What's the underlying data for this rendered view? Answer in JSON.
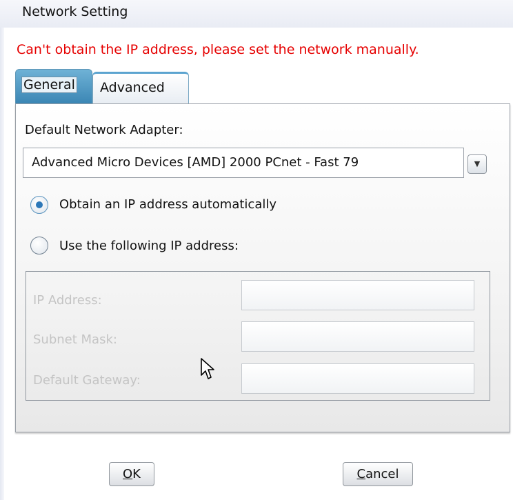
{
  "window": {
    "title": "Network Setting"
  },
  "error_message": "Can't obtain the IP address, please set the network manually.",
  "tabs": [
    {
      "label": "General",
      "selected": true
    },
    {
      "label": "Advanced",
      "selected": false
    }
  ],
  "adapter": {
    "label": "Default Network Adapter:",
    "selected": "Advanced Micro Devices [AMD] 2000  PCnet - Fast 79",
    "dropdown_icon": "triangle-down-icon"
  },
  "ip_mode": {
    "options": [
      {
        "label": "Obtain an IP address automatically",
        "selected": true
      },
      {
        "label": "Use the following IP address:",
        "selected": false
      }
    ]
  },
  "static_ip": {
    "enabled": false,
    "fields": [
      {
        "label": "IP Address:",
        "value": ""
      },
      {
        "label": "Subnet Mask:",
        "value": ""
      },
      {
        "label": "Default Gateway:",
        "value": ""
      }
    ]
  },
  "buttons": {
    "ok": {
      "mnemonic": "O",
      "rest": "K"
    },
    "cancel": {
      "mnemonic": "C",
      "rest": "ancel"
    }
  },
  "colors": {
    "error": "#e60000",
    "tab_active": "#3b86b4",
    "radio_selected": "#2d78b8"
  }
}
